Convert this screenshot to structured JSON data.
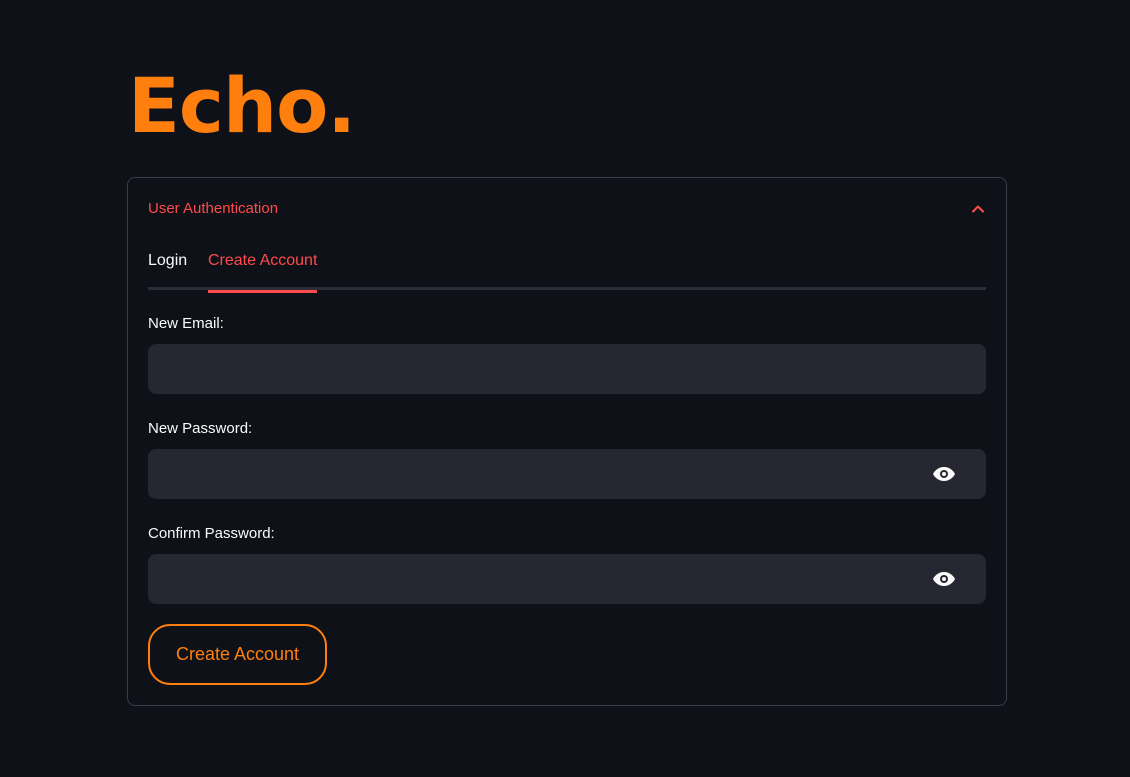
{
  "app": {
    "title": "Echo."
  },
  "expander": {
    "title": "User Authentication"
  },
  "tabs": [
    {
      "label": "Login",
      "active": false
    },
    {
      "label": "Create Account",
      "active": true
    }
  ],
  "form": {
    "email": {
      "label": "New Email:",
      "value": ""
    },
    "password": {
      "label": "New Password:",
      "value": ""
    },
    "confirm": {
      "label": "Confirm Password:",
      "value": ""
    },
    "submit_label": "Create Account"
  },
  "icons": {
    "collapse": "chevron-up-icon",
    "show_password": "eye-icon"
  },
  "colors": {
    "background": "#0e1117",
    "brand": "#ff7f0e",
    "accent": "#ff4b4b",
    "input_bg": "#262730"
  }
}
